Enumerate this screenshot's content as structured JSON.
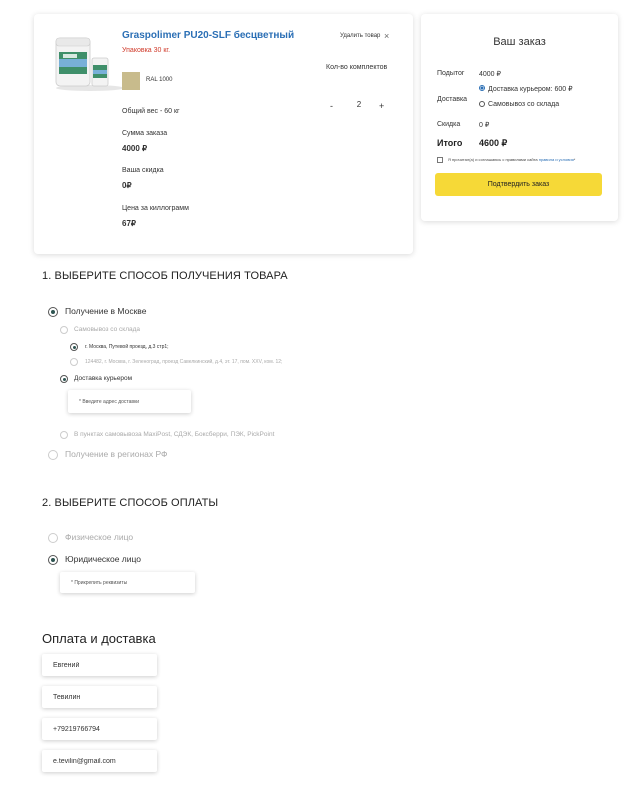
{
  "product": {
    "title": "Graspolimer PU20-SLF бесцветный",
    "packaging": "Упаковка 30 кг.",
    "color_name": "RAL 1000",
    "color_hex": "#c8bb8c",
    "delete_label": "Удалить товар",
    "delete_icon": "×",
    "qty_label": "Кол-во комплектов",
    "qty_minus": "-",
    "qty_value": "2",
    "qty_plus": "+",
    "weight": "Общий вес - 60 кг",
    "sum_label": "Сумма заказа",
    "sum_value": "4000 ₽",
    "discount_label": "Ваша скидка",
    "discount_value": "0₽",
    "price_kg_label": "Цена за киллограмм",
    "price_kg_value": "67₽"
  },
  "order": {
    "title": "Ваш заказ",
    "subtotal_label": "Подытог",
    "subtotal_value": "4000 ₽",
    "delivery_label": "Доставка",
    "delivery_options": [
      "Доставка курьером: 600 ₽",
      "Самовывоз со склада"
    ],
    "discount_label": "Скидка",
    "discount_value": "0 ₽",
    "total_label": "Итого",
    "total_value": "4600 ₽",
    "agree_text": "Я прочитал(а) и соглашаюсь с правилами сайта ",
    "agree_link": "правила и условия",
    "agree_suffix": "*",
    "confirm_label": "Подтвердить заказ",
    "accent_color": "#f6d937"
  },
  "receive": {
    "heading": "1. ВЫБЕРИТЕ СПОСОБ ПОЛУЧЕНИЯ ТОВАРА",
    "moscow": "Получение в Москве",
    "pickup": "Самовывоз со склада",
    "addr1": "г. Москва, Путевой проезд, д.3 стр1;",
    "addr2": "124482, г. Москва, г. Зеленоград, проезд Савелкинский, д.4, эт. 17, пом. XXV, ком. 12;",
    "courier": "Доставка курьером",
    "address_placeholder": "* Введите адрес доставки",
    "points": "В пунктах самовывоза MaxiPost, СДЭК, Боксберри, ПЭК, PickPoint",
    "regions": "Получение в регионах РФ"
  },
  "payment": {
    "heading": "2. ВЫБЕРИТЕ СПОСОБ ОПЛАТЫ",
    "individual": "Физическое лицо",
    "legal": "Юридическое лицо",
    "requisites_placeholder": "* Прикрепить реквизиты"
  },
  "contacts": {
    "heading": "Оплата и доставка",
    "first_name": "Евгений",
    "last_name": "Тевилин",
    "phone": "+79219766794",
    "email": "e.tevilin@gmail.com"
  }
}
